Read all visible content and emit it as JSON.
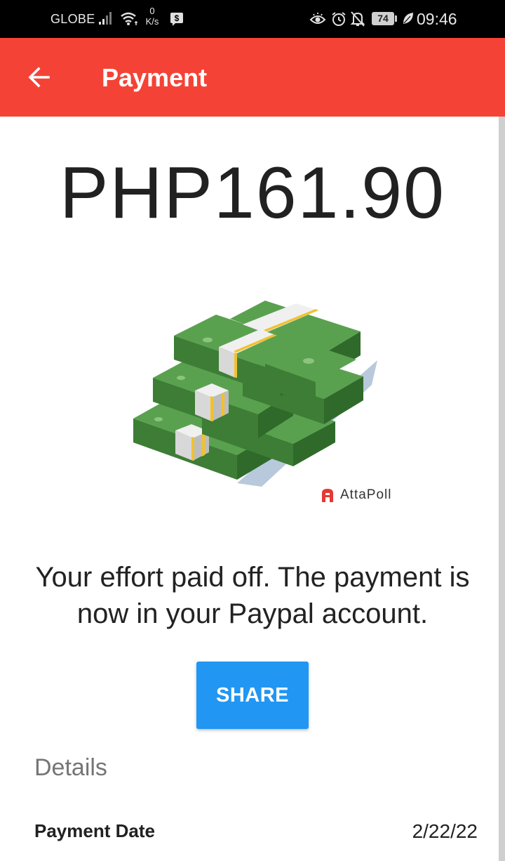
{
  "status_bar": {
    "carrier": "GLOBE",
    "speed_value": "0",
    "speed_unit": "K/s",
    "battery": "74",
    "time": "09:46"
  },
  "app_bar": {
    "title": "Payment",
    "back_icon": "arrow-back-icon",
    "color": "#f44336"
  },
  "payment": {
    "amount": "PHP161.90",
    "illustration": "money-stacks",
    "brand": "AttaPoll",
    "message": "Your effort paid off. The payment is now in your Paypal account.",
    "share_label": "SHARE",
    "share_color": "#2196f3"
  },
  "details": {
    "heading": "Details",
    "rows": [
      {
        "label": "Payment Date",
        "value": "2/22/22"
      }
    ]
  }
}
